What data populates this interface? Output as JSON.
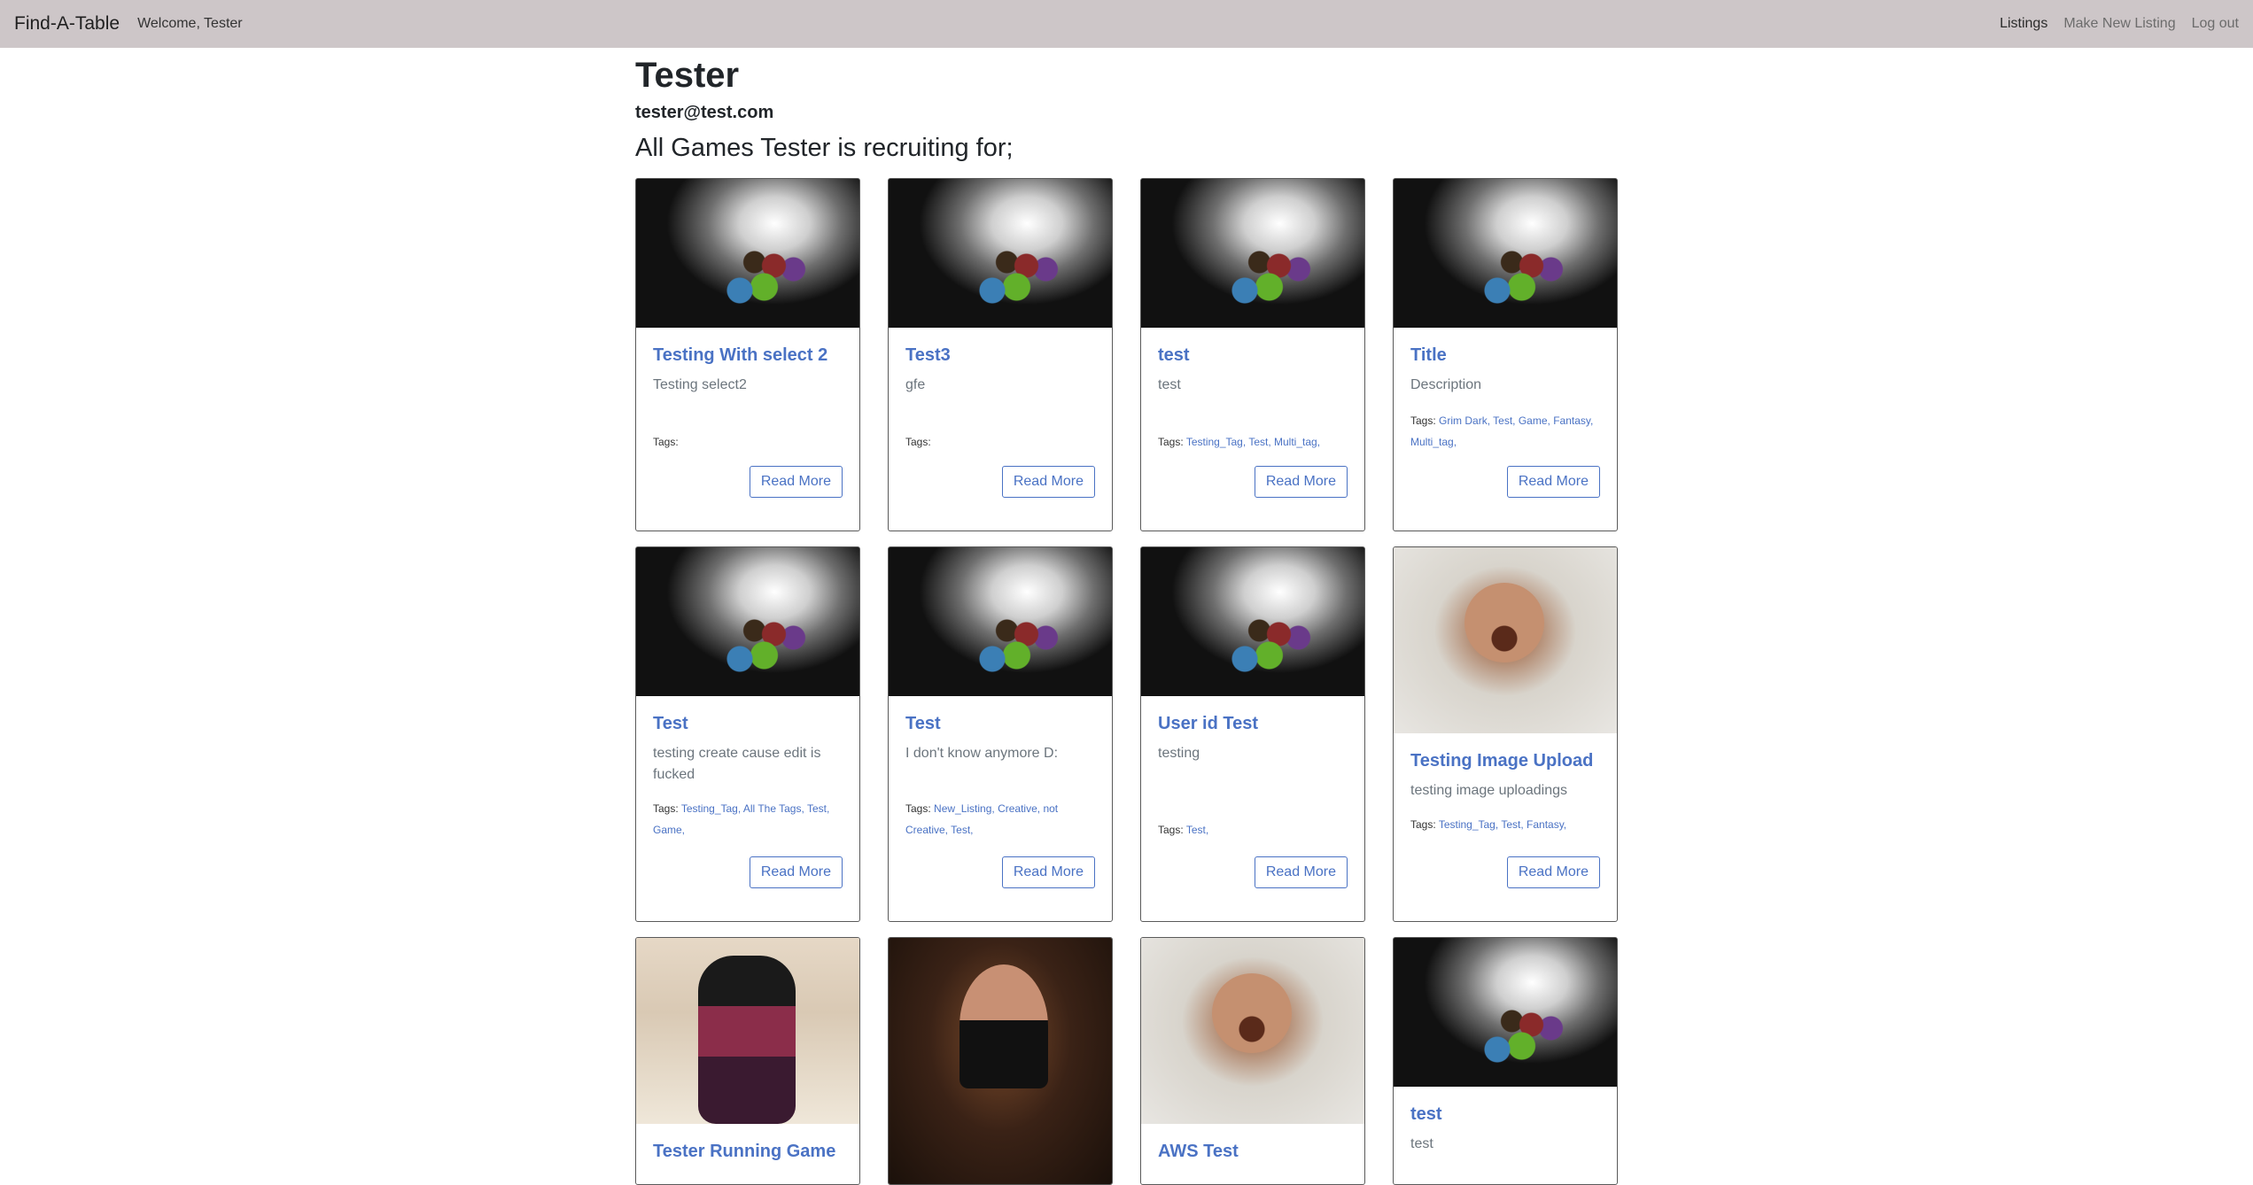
{
  "nav": {
    "brand": "Find-A-Table",
    "welcome": "Welcome, Tester",
    "links": [
      "Listings",
      "Make New Listing",
      "Log out"
    ]
  },
  "profile": {
    "name": "Tester",
    "email": "tester@test.com",
    "section_title": "All Games Tester is recruiting for;"
  },
  "cards": [
    {
      "title": "Testing With select 2",
      "desc": "Testing select2",
      "tags_label": "Tags:",
      "tags": [],
      "button": "Read More",
      "image": "dice"
    },
    {
      "title": "Test3",
      "desc": "gfe",
      "tags_label": "Tags:",
      "tags": [],
      "button": "Read More",
      "image": "dice"
    },
    {
      "title": "test",
      "desc": "test",
      "tags_label": "Tags:",
      "tags": [
        "Testing_Tag,",
        "Test,",
        "Multi_tag,"
      ],
      "button": "Read More",
      "image": "dice"
    },
    {
      "title": "Title",
      "desc": "Description",
      "tags_label": "Tags:",
      "tags": [
        "Grim Dark,",
        "Test,",
        "Game,",
        "Fantasy,",
        "Multi_tag,"
      ],
      "button": "Read More",
      "image": "dice"
    },
    {
      "title": "Test",
      "desc": "testing create cause edit is fucked",
      "tags_label": "Tags:",
      "tags": [
        "Testing_Tag,",
        "All The Tags,",
        "Test,",
        "Game,"
      ],
      "button": "Read More",
      "image": "dice"
    },
    {
      "title": "Test",
      "desc": "I don't know anymore D:",
      "tags_label": "Tags:",
      "tags": [
        "New_Listing,",
        "Creative,",
        "not Creative,",
        "Test,"
      ],
      "button": "Read More",
      "image": "dice"
    },
    {
      "title": "User id Test",
      "desc": "testing",
      "tags_label": "Tags:",
      "tags": [
        "Test,"
      ],
      "button": "Read More",
      "image": "dice"
    },
    {
      "title": "Testing Image Upload",
      "desc": "testing image uploadings",
      "tags_label": "Tags:",
      "tags": [
        "Testing_Tag,",
        "Test,",
        "Fantasy,"
      ],
      "button": "Read More",
      "image": "faun"
    },
    {
      "title": "Tester Running Game",
      "desc": "",
      "tags_label": "",
      "tags": [],
      "button": "",
      "image": "garnet"
    },
    {
      "title": "",
      "desc": "",
      "tags_label": "",
      "tags": [],
      "button": "",
      "image": "person"
    },
    {
      "title": "AWS Test",
      "desc": "",
      "tags_label": "",
      "tags": [],
      "button": "",
      "image": "faun"
    },
    {
      "title": "test",
      "desc": "test",
      "tags_label": "",
      "tags": [],
      "button": "",
      "image": "dice"
    }
  ]
}
